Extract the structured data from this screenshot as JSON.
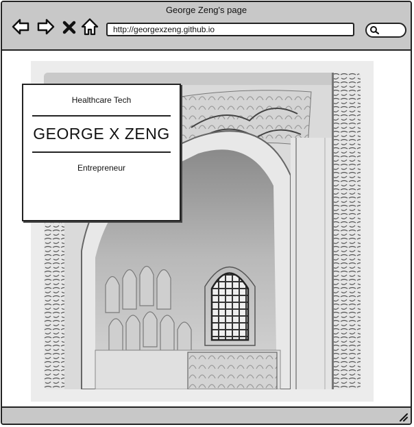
{
  "window": {
    "title": "George Zeng's page"
  },
  "toolbar": {
    "icons": [
      "back-arrow-icon",
      "forward-arrow-icon",
      "close-x-icon",
      "home-icon",
      "search-icon"
    ],
    "url": "http://georgexzeng.github.io",
    "search_value": ""
  },
  "hero_card": {
    "top_label": "Healthcare Tech",
    "name": "GEORGE X ZENG",
    "bottom_label": "Entrepreneur"
  },
  "colors": {
    "chrome": "#c8c8c8",
    "border": "#222222",
    "page": "#ffffff"
  }
}
